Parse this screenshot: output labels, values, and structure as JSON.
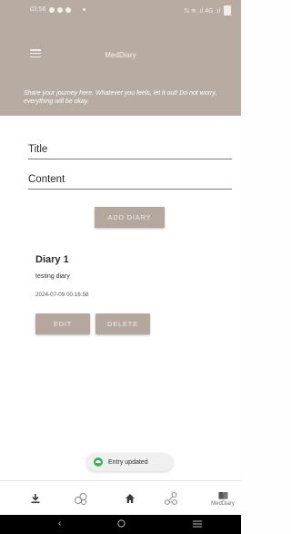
{
  "status_bar": {
    "time": "02:56",
    "right_icons_text": "ℕ ≋ .ıl 4G .ıl"
  },
  "app_bar": {
    "title": "MedDiary",
    "menu_icon": "hamburger-menu-icon"
  },
  "subtitle": "Share your journey here. Whatever you feels, let it out! Do not worry, everything will be okay.",
  "form": {
    "title_placeholder": "Title",
    "content_placeholder": "Content",
    "add_button_label": "ADD DIARY"
  },
  "diary_entries": [
    {
      "title": "Diary 1",
      "content": "testing diary",
      "date": "2024-07-09 00:16:58",
      "edit_label": "EDIT",
      "delete_label": "DELETE"
    }
  ],
  "toast": {
    "message": "Entry updated"
  },
  "bottom_nav": {
    "items": [
      {
        "icon": "download-icon",
        "label": ""
      },
      {
        "icon": "molecule-icon",
        "label": ""
      },
      {
        "icon": "home-icon",
        "label": ""
      },
      {
        "icon": "share-icon",
        "label": ""
      },
      {
        "icon": "book-icon",
        "label": "MedDiary"
      }
    ]
  },
  "colors": {
    "header_bg": "#b8aca2",
    "button_bg": "#b4a89e",
    "toast_icon": "#3fae62"
  }
}
